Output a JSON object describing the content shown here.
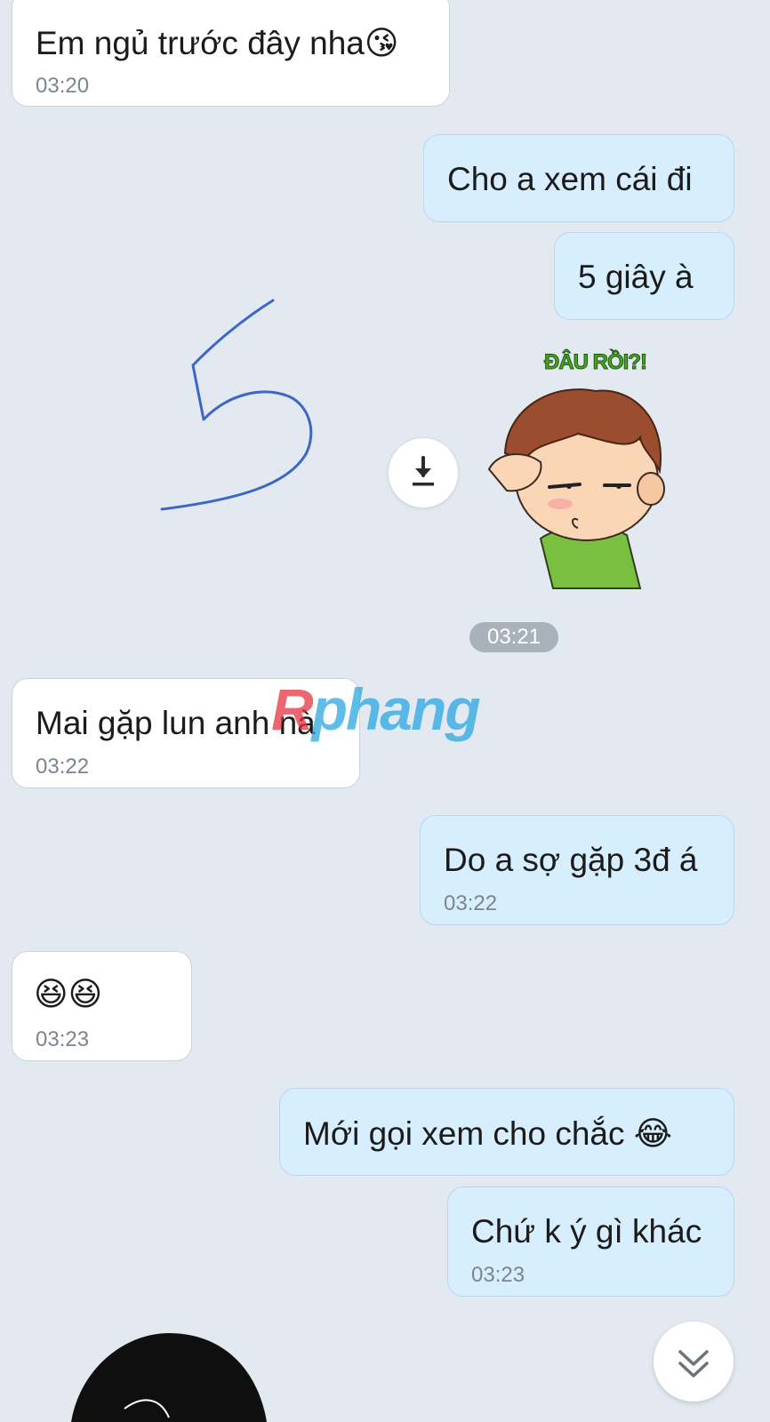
{
  "messages": [
    {
      "text": "Em ngủ trước đây nha",
      "emoji": "😘",
      "time": "03:20"
    },
    {
      "text": "Cho a xem cái đi"
    },
    {
      "text": "5 giây à"
    },
    {
      "text": "Mai gặp lun anh nà",
      "time": "03:22"
    },
    {
      "text": "Do a sợ gặp 3đ á",
      "time": "03:22"
    },
    {
      "emoji": "😆😆",
      "time": "03:23"
    },
    {
      "text": "Mới gọi xem cho chắc ",
      "emoji": "😂"
    },
    {
      "text": "Chứ k ý gì khác",
      "time": "03:23"
    }
  ],
  "sticker": {
    "caption": "ĐÂU RỒI?!",
    "time": "03:21"
  },
  "watermark": {
    "first": "R",
    "rest": "phang"
  },
  "colors": {
    "incoming": "#ffffff",
    "outgoing": "#d6eefd",
    "background": "#e3e9f1",
    "drawing_stroke": "#3d66c8"
  },
  "icons": {
    "download": "download-icon",
    "scroll": "double-chevron-down-icon"
  }
}
